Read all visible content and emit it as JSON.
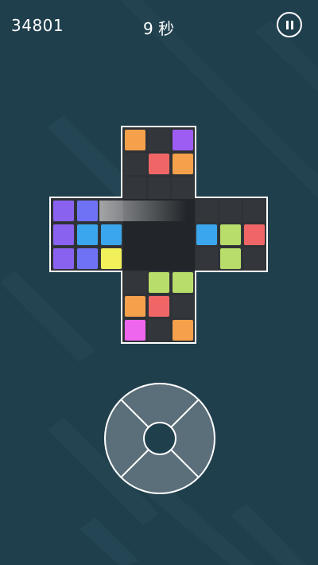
{
  "hud": {
    "score": "34801",
    "timer": "9 秒",
    "pause_icon": "pause-icon"
  },
  "colors": {
    "background": "#203f4d",
    "board_cell": "#2e3135",
    "board_border": "#ffffff",
    "orange": "#f5a04a",
    "purple": "#9d5cf2",
    "red": "#f06666",
    "violet": "#8a62f0",
    "indigo": "#6f72f4",
    "blue": "#3aa6ee",
    "yellow": "#f1f05a",
    "lime": "#b9dd6a",
    "pink": "#ee66ee",
    "dpad_fill": "#5a6f7a"
  },
  "board": {
    "top_arm": [
      [
        "orange",
        null,
        "purple"
      ],
      [
        null,
        "red",
        "orange"
      ],
      [
        null,
        null,
        null
      ]
    ],
    "left_arm": [
      [
        "violet",
        "indigo",
        null
      ],
      [
        "violet",
        "blue",
        "blue"
      ],
      [
        "violet",
        "indigo",
        "yellow"
      ]
    ],
    "right_arm": [
      [
        null,
        null,
        null
      ],
      [
        "blue",
        "lime",
        "red"
      ],
      [
        null,
        "lime",
        null
      ]
    ],
    "bottom_arm": [
      [
        null,
        "lime",
        "lime"
      ],
      [
        "orange",
        "red",
        null
      ],
      [
        "pink",
        null,
        "orange"
      ]
    ]
  },
  "controls": {
    "dpad_icon": "directional-pad"
  }
}
